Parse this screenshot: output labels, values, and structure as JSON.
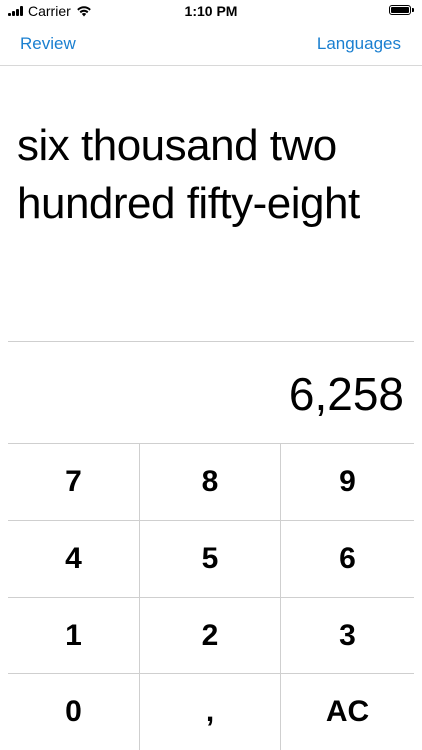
{
  "status_bar": {
    "carrier": "Carrier",
    "time": "1:10 PM",
    "icons": [
      "signal-icon",
      "wifi-icon",
      "battery-icon"
    ]
  },
  "nav": {
    "left_label": "Review",
    "right_label": "Languages",
    "accent_color": "#1a7fd0"
  },
  "display": {
    "words": "six thousand two hundred fifty-eight",
    "number": "6,258"
  },
  "keypad": {
    "keys": [
      "7",
      "8",
      "9",
      "4",
      "5",
      "6",
      "1",
      "2",
      "3",
      "0",
      ",",
      "AC"
    ]
  }
}
